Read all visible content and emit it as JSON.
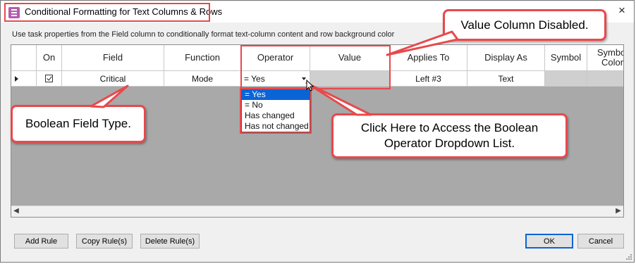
{
  "window": {
    "title": "Conditional Formatting for Text Columns & Rows",
    "close_icon": "×"
  },
  "description": "Use task properties from the Field column to conditionally format text-column content and row background color",
  "grid": {
    "columns": [
      "On",
      "Field",
      "Function",
      "Operator",
      "Value",
      "Applies To",
      "Display As",
      "Symbol",
      "Symbol Color"
    ],
    "row": {
      "on_checked": true,
      "field": "Critical",
      "function": "Mode",
      "operator": "= Yes",
      "value": "",
      "applies_to": "Left #3",
      "display_as": "Text",
      "symbol": "",
      "symbol_color": ""
    }
  },
  "operator_dropdown": {
    "options": [
      "= Yes",
      "= No",
      "Has changed",
      "Has not changed"
    ],
    "selected": "= Yes"
  },
  "callouts": {
    "value_disabled": "Value Column Disabled.",
    "boolean_field": "Boolean Field Type.",
    "operator_help": "Click Here to Access the Boolean Operator Dropdown List."
  },
  "buttons": {
    "add_rule": "Add Rule",
    "copy_rules": "Copy Rule(s)",
    "delete_rules": "Delete Rule(s)",
    "ok": "OK",
    "cancel": "Cancel"
  },
  "colors": {
    "annotation_red": "#e8494c",
    "selection_blue": "#0a64d6",
    "grid_empty": "#a9a9a9",
    "disabled_cell": "#cfcfcf"
  }
}
